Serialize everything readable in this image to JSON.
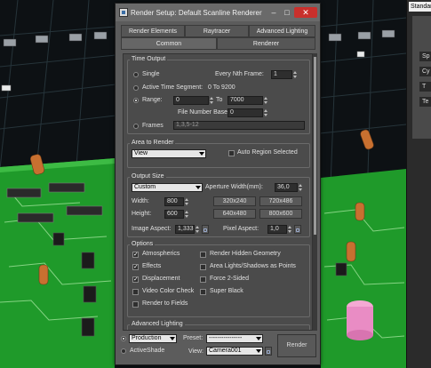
{
  "dialog": {
    "title": "Render Setup: Default Scanline Renderer",
    "tabs_row1": [
      "Render Elements",
      "Raytracer",
      "Advanced Lighting"
    ],
    "tabs_row2": [
      "Common",
      "Renderer"
    ]
  },
  "time_output": {
    "title": "Time Output",
    "single": "Single",
    "every_nth_label": "Every Nth Frame:",
    "every_nth_value": "1",
    "active_segment_label": "Active Time Segment:",
    "active_segment_value": "0 To 9200",
    "range_label": "Range:",
    "range_from": "0",
    "range_to_label": "To",
    "range_to": "7000",
    "file_number_base_label": "File Number Base:",
    "file_number_base_value": "0",
    "frames_label": "Frames",
    "frames_value": "1,3,5-12",
    "selected": "Range"
  },
  "area_to_render": {
    "title": "Area to Render",
    "value": "View",
    "auto_region_label": "Auto Region Selected"
  },
  "output_size": {
    "title": "Output Size",
    "preset": "Custom",
    "aperture_label": "Aperture Width(mm):",
    "aperture_value": "36,0",
    "width_label": "Width:",
    "width_value": "800",
    "height_label": "Height:",
    "height_value": "600",
    "presets": [
      "320x240",
      "720x486",
      "640x480",
      "800x600"
    ],
    "image_aspect_label": "Image Aspect:",
    "image_aspect_value": "1,333",
    "pixel_aspect_label": "Pixel Aspect:",
    "pixel_aspect_value": "1,0"
  },
  "options": {
    "title": "Options",
    "left": [
      {
        "label": "Atmospherics",
        "checked": true
      },
      {
        "label": "Effects",
        "checked": true
      },
      {
        "label": "Displacement",
        "checked": true
      },
      {
        "label": "Video Color Check",
        "checked": false
      },
      {
        "label": "Render to Fields",
        "checked": false
      }
    ],
    "right": [
      {
        "label": "Render Hidden Geometry",
        "checked": false
      },
      {
        "label": "Area Lights/Shadows as Points",
        "checked": false
      },
      {
        "label": "Force 2-Sided",
        "checked": false
      },
      {
        "label": "Super Black",
        "checked": false
      }
    ]
  },
  "advanced_lighting": {
    "title": "Advanced Lighting"
  },
  "bottom": {
    "mode": "Production",
    "activeshade_label": "ActiveShade",
    "preset_label": "Preset:",
    "preset_value": "----------------",
    "view_label": "View:",
    "view_value": "Camera001",
    "render_label": "Render"
  },
  "command_panel": {
    "dropdown": "Standard",
    "rollouts": [
      "Sp",
      "Cy",
      "T",
      "Te"
    ]
  },
  "colors": {
    "pcb_green": "#1f9a2a",
    "dialog_bg": "#5c5c5c",
    "close_red": "#c9302c"
  }
}
